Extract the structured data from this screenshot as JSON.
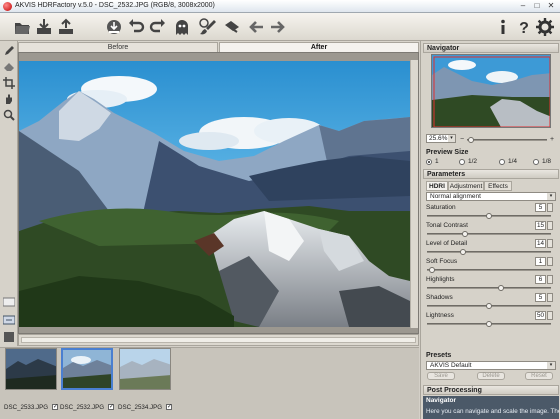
{
  "window": {
    "title": "AKVIS HDRFactory v.5.0 - DSC_2532.JPG (RGB/8, 3008x2000)",
    "minimize": "–",
    "maximize": "□",
    "close": "✕"
  },
  "toolbar": {
    "icons": [
      "open-file-icon",
      "save-icon",
      "import-icon",
      "undo-icon",
      "redo-icon",
      "ghost-icon",
      "brush-icon",
      "eraser-icon",
      "arrow-left-icon",
      "arrow-right-icon",
      "info-icon",
      "help-icon",
      "settings-icon"
    ]
  },
  "view_tabs": {
    "before": "Before",
    "after": "After"
  },
  "filmstrip": {
    "items": [
      {
        "label": "DSC_2533.JPG",
        "checked": true,
        "selected": false
      },
      {
        "label": "DSC_2532.JPG",
        "checked": true,
        "selected": true
      },
      {
        "label": "DSC_2534.JPG",
        "checked": true,
        "selected": false
      }
    ],
    "check_mark": "✓"
  },
  "navigator": {
    "header": "Navigator",
    "zoom": "25.6%",
    "minus": "−",
    "plus": "+",
    "dropdown_arrow": "▾"
  },
  "preview_size": {
    "header": "Preview Size",
    "options": [
      "1",
      "1/2",
      "1/4",
      "1/8"
    ],
    "selected_index": 0
  },
  "parameters": {
    "header": "Parameters",
    "tabs": [
      "HDRI",
      "Adjustment",
      "Effects"
    ],
    "active_tab": 0,
    "alignment": "Normal alignment",
    "items": [
      {
        "label": "Saturation",
        "value": "5",
        "max": 10
      },
      {
        "label": "Tonal Contrast",
        "value": "15",
        "max": 50
      },
      {
        "label": "Level of Detail",
        "value": "14",
        "max": 50
      },
      {
        "label": "Soft Focus",
        "value": "1",
        "max": 50
      },
      {
        "label": "Highlights",
        "value": "6",
        "max": 10
      },
      {
        "label": "Shadows",
        "value": "5",
        "max": 10
      },
      {
        "label": "Lightness",
        "value": "50",
        "max": 100
      }
    ]
  },
  "presets": {
    "header": "Presets",
    "current": "AKVIS Default",
    "save": "Save",
    "delete": "Delete",
    "reset": "Reset"
  },
  "post_processing": {
    "header": "Post Processing"
  },
  "help": {
    "title": "Navigator",
    "text": "Here you can navigate and scale the image. The"
  },
  "colors": {
    "accent": "#4a7fd0",
    "help_bg": "#4b5968"
  }
}
